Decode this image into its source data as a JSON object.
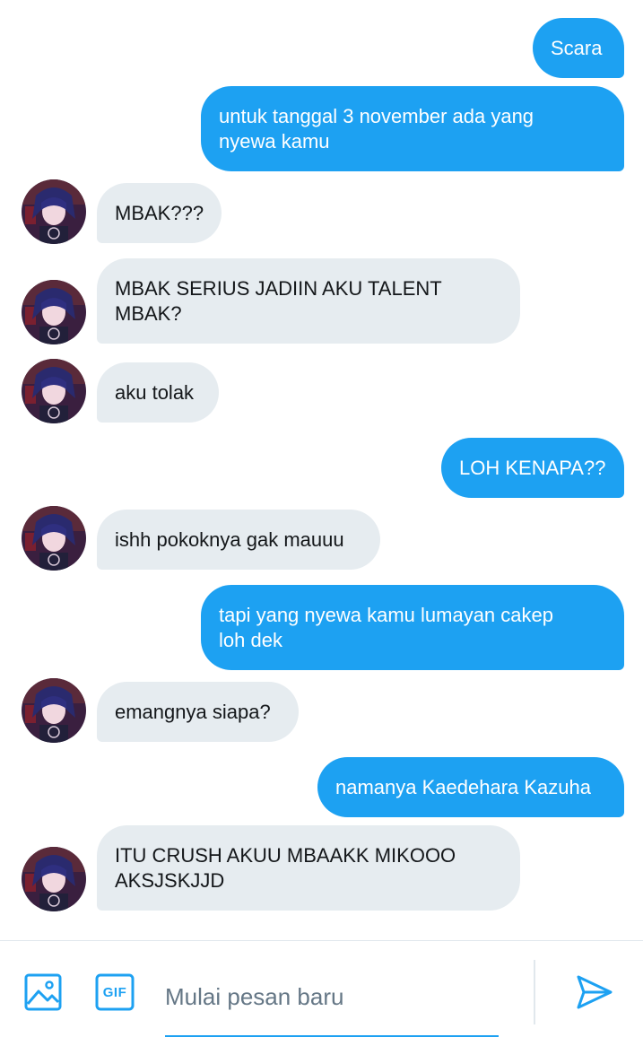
{
  "messages": [
    {
      "side": "out",
      "text": "Scara"
    },
    {
      "side": "out",
      "text": "untuk tanggal 3 november ada yang\nnyewa kamu"
    },
    {
      "side": "in",
      "text": "MBAK???"
    },
    {
      "side": "in",
      "text": "MBAK SERIUS JADIIN AKU TALENT\nMBAK?"
    },
    {
      "side": "in",
      "text": "aku tolak"
    },
    {
      "side": "out",
      "text": "LOH KENAPA??"
    },
    {
      "side": "in",
      "text": "ishh pokoknya gak mauuu"
    },
    {
      "side": "out",
      "text": "tapi yang nyewa kamu lumayan cakep\nloh dek"
    },
    {
      "side": "in",
      "text": "emangnya siapa?"
    },
    {
      "side": "out",
      "text": "namanya Kaedehara Kazuha"
    },
    {
      "side": "in",
      "text": "ITU CRUSH AKUU MBAAKK MIKOOO\nAKSJSKJJD"
    }
  ],
  "composer": {
    "placeholder": "Mulai pesan baru",
    "image_icon": "image-icon",
    "gif_label": "GIF",
    "send_icon": "send-icon"
  },
  "colors": {
    "accent": "#1da1f2",
    "incoming_bubble": "#e6ecf0",
    "text": "#14171a",
    "placeholder": "#657786"
  }
}
